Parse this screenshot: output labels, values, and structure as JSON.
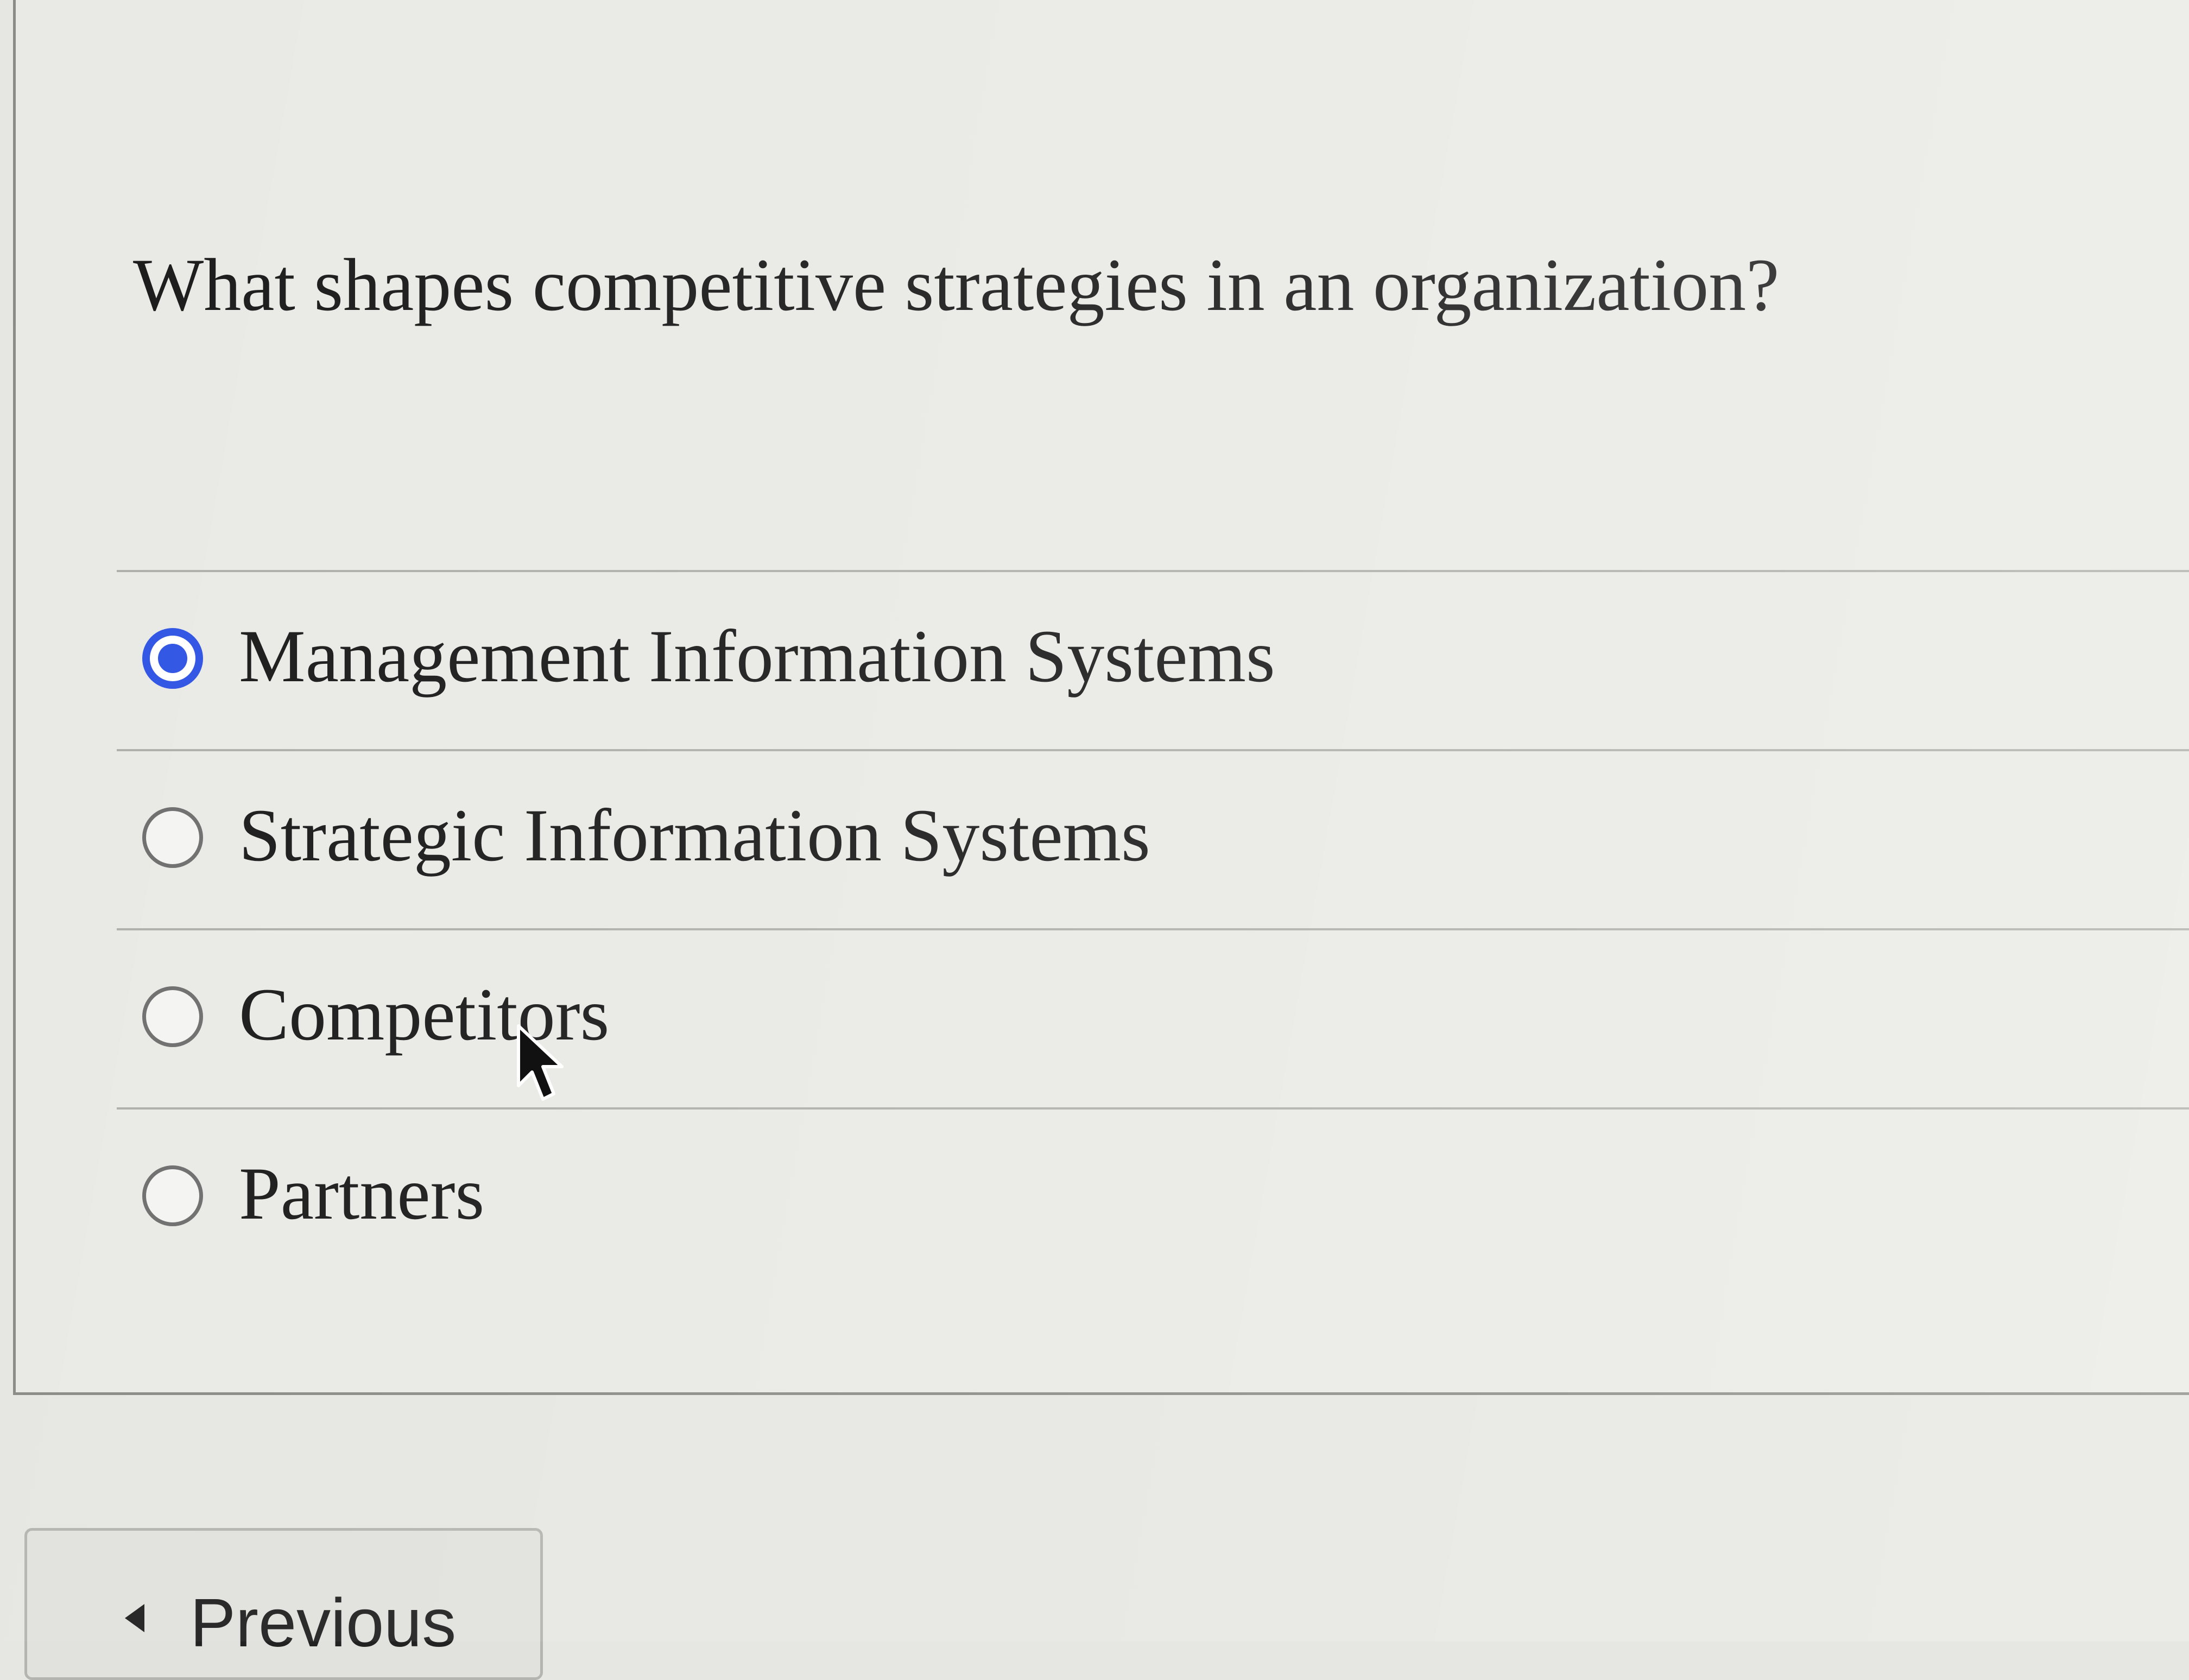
{
  "question": {
    "text": "What shapes competitive strategies in an organization?"
  },
  "options": [
    {
      "label": "Management Information Systems",
      "selected": true
    },
    {
      "label": "Strategic Information Systems",
      "selected": false
    },
    {
      "label": "Competitors",
      "selected": false
    },
    {
      "label": "Partners",
      "selected": false
    }
  ],
  "navigation": {
    "previous_label": "Previous",
    "previous_icon": "caret-left-icon"
  },
  "colors": {
    "radio_selected": "#2f54e4",
    "background": "#e6e6e2"
  }
}
